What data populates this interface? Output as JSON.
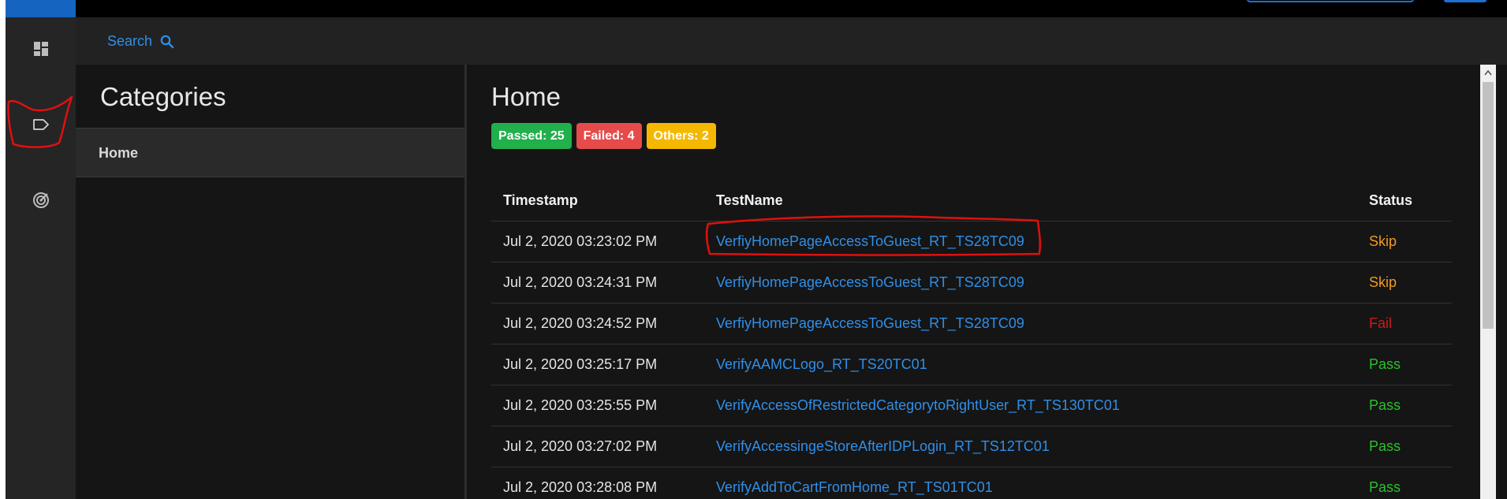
{
  "search": {
    "label": "Search"
  },
  "rail": {
    "items": [
      "dashboard-icon",
      "tag-icon",
      "radar-icon"
    ]
  },
  "categories": {
    "title": "Categories",
    "items": [
      {
        "label": "Home"
      }
    ]
  },
  "main": {
    "title": "Home",
    "badges": {
      "passed": "Passed: 25",
      "failed": "Failed: 4",
      "others": "Others: 2"
    },
    "columns": {
      "timestamp": "Timestamp",
      "testname": "TestName",
      "status": "Status"
    },
    "rows": [
      {
        "timestamp": "Jul 2, 2020 03:23:02 PM",
        "name": "VerfiyHomePageAccessToGuest_RT_TS28TC09",
        "status": "Skip"
      },
      {
        "timestamp": "Jul 2, 2020 03:24:31 PM",
        "name": "VerfiyHomePageAccessToGuest_RT_TS28TC09",
        "status": "Skip"
      },
      {
        "timestamp": "Jul 2, 2020 03:24:52 PM",
        "name": "VerfiyHomePageAccessToGuest_RT_TS28TC09",
        "status": "Fail"
      },
      {
        "timestamp": "Jul 2, 2020 03:25:17 PM",
        "name": "VerifyAAMCLogo_RT_TS20TC01",
        "status": "Pass"
      },
      {
        "timestamp": "Jul 2, 2020 03:25:55 PM",
        "name": "VerifyAccessOfRestrictedCategorytoRightUser_RT_TS130TC01",
        "status": "Pass"
      },
      {
        "timestamp": "Jul 2, 2020 03:27:02 PM",
        "name": "VerifyAccessingeStoreAfterIDPLogin_RT_TS12TC01",
        "status": "Pass"
      },
      {
        "timestamp": "Jul 2, 2020 03:28:08 PM",
        "name": "VerifyAddToCartFromHome_RT_TS01TC01",
        "status": "Pass"
      }
    ]
  },
  "colors": {
    "link": "#2f8fe8",
    "pass": "#2bc02b",
    "fail": "#d11a1a",
    "skip": "#f29a1e",
    "badge_pass": "#21b04b",
    "badge_fail": "#e64b4b",
    "badge_other": "#f5b800",
    "annotation": "#e01010"
  }
}
